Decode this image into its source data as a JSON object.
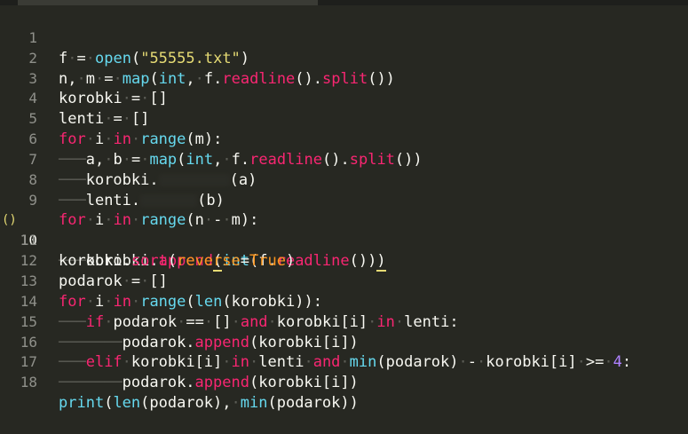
{
  "editor": {
    "line_numbers": [
      "1",
      "2",
      "3",
      "4",
      "5",
      "6",
      "7",
      "8",
      "9",
      "10",
      "11",
      "12",
      "13",
      "14",
      "15",
      "16",
      "17",
      "18"
    ],
    "breakpoint_marker": "()",
    "lines": [
      "f = open(\"55555.txt\")",
      "n, m = map(int, f.readline().split())",
      "korobki = []",
      "lenti = []",
      "for i in range(m):",
      "    a, b = map(int, f.readline().split())",
      "    korobki.        (a)",
      "    lenti.        (b)",
      "for i in range(n - m):",
      "    korobki.append(int(f.readline()))",
      "korobki.sort(reverse=True)",
      "podarok = []",
      "for i in range(len(korobki)):",
      "    if podarok == [] and korobki[i] in lenti:",
      "        podarok.append(korobki[i])",
      "    elif korobki[i] in lenti and min(podarok) - korobki[i] >= 4:",
      "        podarok.append(korobki[i])",
      "print(len(podarok), min(podarok))"
    ]
  },
  "tokens": {
    "open": "open",
    "fname": "\"55555.txt\"",
    "map": "map",
    "int": "int",
    "f_readline": "readline",
    "split": "split",
    "for": "for",
    "in": "in",
    "range": "range",
    "append": "append",
    "sort": "sort",
    "reverse": "reverse",
    "True": "True",
    "len": "len",
    "if": "if",
    "and": "and",
    "elif": "elif",
    "min": "min",
    "print": "print",
    "four": "4"
  },
  "colors": {
    "background": "#272822",
    "keyword": "#66d9ef",
    "method": "#f92672",
    "string": "#e6db74",
    "number": "#ae81ff",
    "parameter": "#fd971f",
    "whitespace_markers": "#5b5c55"
  }
}
